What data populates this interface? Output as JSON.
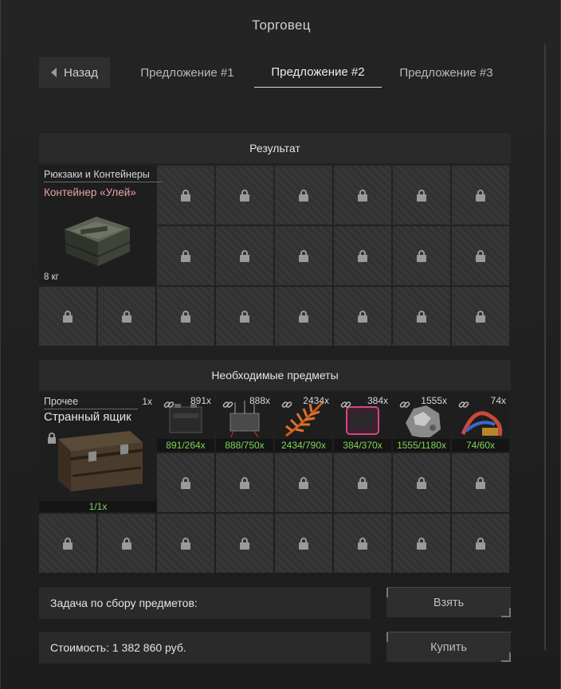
{
  "window": {
    "title": "Торговец"
  },
  "tabs": {
    "back_label": "Назад",
    "items": [
      {
        "label": "Предложение #1",
        "active": false
      },
      {
        "label": "Предложение #2",
        "active": true
      },
      {
        "label": "Предложение #3",
        "active": false
      }
    ]
  },
  "result": {
    "header": "Результат",
    "item": {
      "category": "Рюкзаки и Контейнеры",
      "name": "Контейнер «Улей»",
      "weight": "8 кг",
      "icon": "container-image"
    },
    "locked_slot_icon": "lock-icon"
  },
  "required": {
    "header": "Необходимые предметы",
    "main_item": {
      "category": "Прочее",
      "quantity": "1x",
      "name": "Странный ящик",
      "progress": "1/1x",
      "icon": "strange-box-image"
    },
    "items": [
      {
        "count": "891x",
        "progress": "891/264x",
        "icon": "battery-icon"
      },
      {
        "count": "888x",
        "progress": "888/750x",
        "icon": "circuit-icon"
      },
      {
        "count": "2434x",
        "progress": "2434/790x",
        "icon": "fern-icon"
      },
      {
        "count": "384x",
        "progress": "384/370x",
        "icon": "device-icon"
      },
      {
        "count": "1555x",
        "progress": "1555/1180x",
        "icon": "ore-icon"
      },
      {
        "count": "74x",
        "progress": "74/60x",
        "icon": "wires-icon"
      }
    ]
  },
  "task": {
    "label": "Задача по сбору предметов:"
  },
  "cost": {
    "label": "Стоимость: 1 382 860  руб."
  },
  "buttons": {
    "take": "Взять",
    "buy": "Купить"
  },
  "colors": {
    "progress_green": "#7fd45a",
    "item_name_red": "#e8a3a3",
    "panel_bg": "#2a2a2a"
  }
}
